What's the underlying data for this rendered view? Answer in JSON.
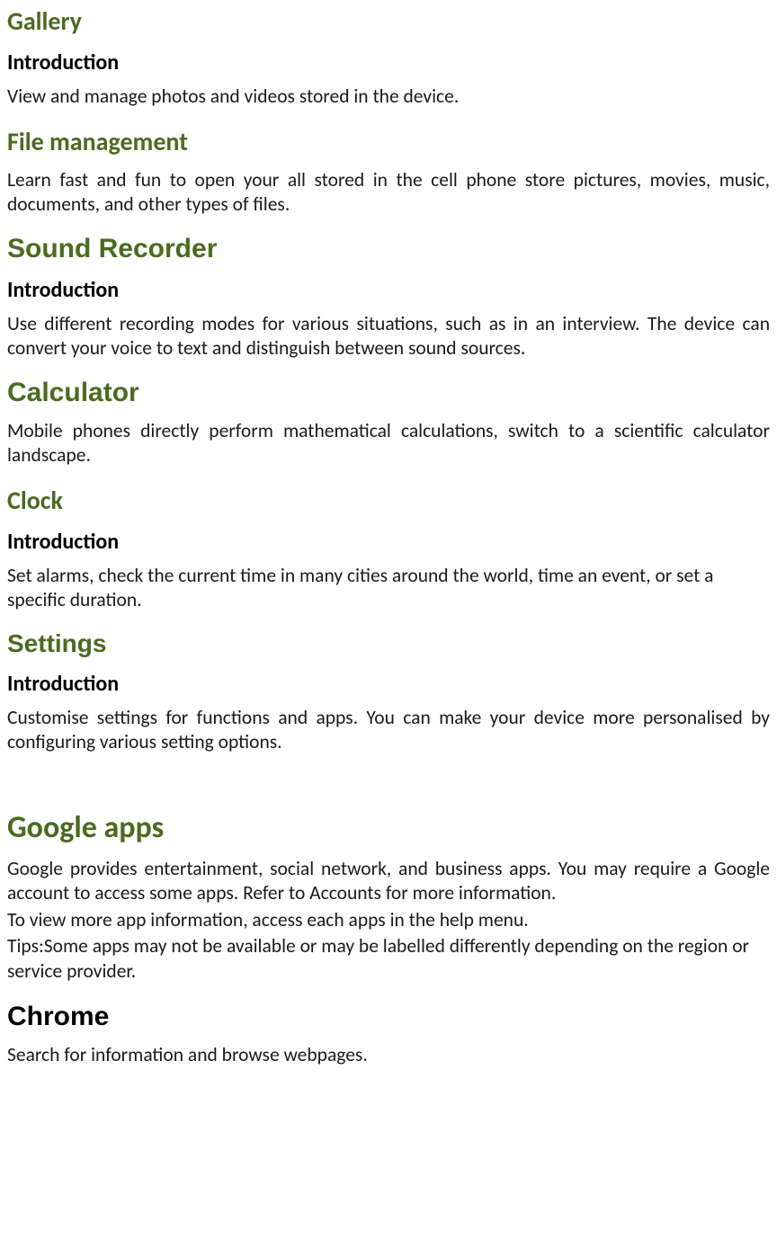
{
  "gallery": {
    "heading": "Gallery",
    "intro_label": "Introduction",
    "intro_text": "View and manage photos and videos stored in the device."
  },
  "file": {
    "heading": "File management",
    "text": "Learn fast and fun to open your all stored in the cell phone store pictures, movies, music, documents, and other types of files."
  },
  "sound": {
    "heading": "Sound Recorder",
    "intro_label": "Introduction",
    "intro_text": "Use different recording modes for various situations, such as in an interview. The device can convert your voice to text and distinguish between sound sources."
  },
  "calc": {
    "heading": "Calculator",
    "text": "Mobile phones directly perform mathematical calculations, switch to a scientific calculator landscape."
  },
  "clock": {
    "heading": "Clock",
    "intro_label": "Introduction",
    "intro_text": "Set alarms, check the current time in many cities around the world, time an event, or set a specific duration."
  },
  "settings": {
    "heading": "Settings",
    "intro_label": "Introduction",
    "intro_text": "Customise settings for functions and apps. You can make your device more personalised by configuring various setting options."
  },
  "google": {
    "heading": "Google apps",
    "line1": "Google provides entertainment, social network, and business apps. You may require a Google account to access some apps. Refer to Accounts for more information.",
    "line2": "To view more app information, access each apps in the help menu.",
    "line3": "Tips:Some apps may not be available or may be labelled differently depending on the region or service provider."
  },
  "chrome": {
    "heading": "Chrome",
    "text": "Search for information and browse webpages."
  }
}
